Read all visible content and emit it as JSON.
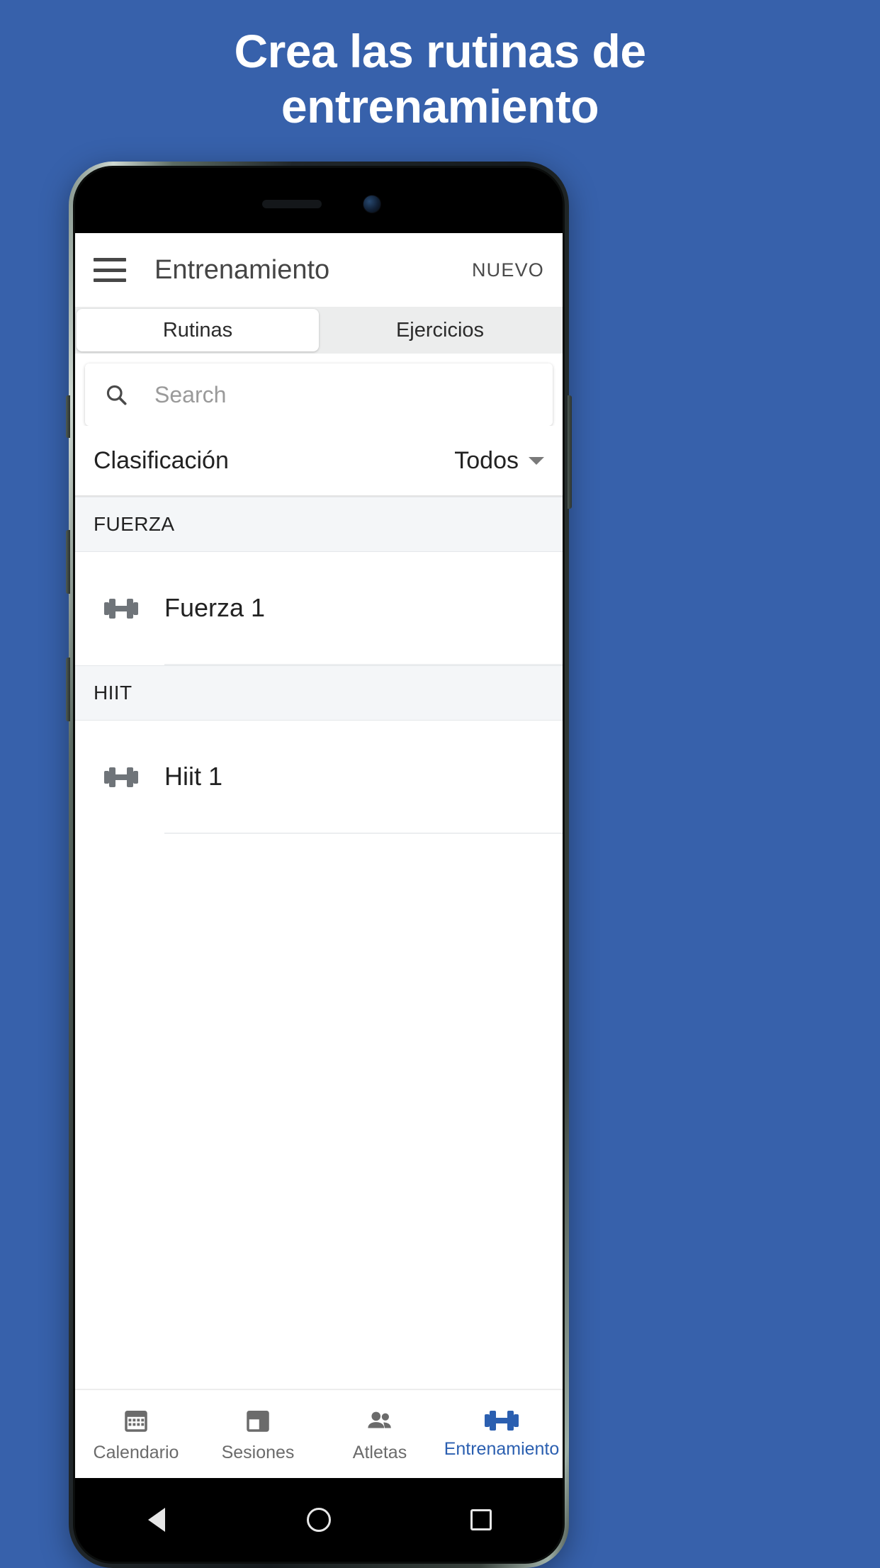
{
  "marketing": {
    "headline_line1": "Crea las rutinas de",
    "headline_line2": "entrenamiento",
    "background_color": "#3761ab",
    "headline_color": "#ffffff"
  },
  "app": {
    "toolbar": {
      "menu_icon": "hamburger-menu-icon",
      "title": "Entrenamiento",
      "action_label": "NUEVO"
    },
    "tabs": [
      {
        "label": "Rutinas",
        "active": true
      },
      {
        "label": "Ejercicios",
        "active": false
      }
    ],
    "search": {
      "icon": "search-icon",
      "placeholder": "Search",
      "value": ""
    },
    "filter": {
      "label": "Clasificación",
      "value": "Todos",
      "caret_icon": "chevron-down-icon"
    },
    "list": [
      {
        "group": "FUERZA",
        "items": [
          {
            "icon": "dumbbell-icon",
            "label": "Fuerza 1"
          }
        ]
      },
      {
        "group": "HIIT",
        "items": [
          {
            "icon": "dumbbell-icon",
            "label": "Hiit 1"
          }
        ]
      }
    ],
    "bottom_nav": {
      "accent_color": "#2b5fb0",
      "inactive_color": "#6b6b6b",
      "items": [
        {
          "label": "Calendario",
          "icon": "calendar-icon",
          "active": false
        },
        {
          "label": "Sesiones",
          "icon": "sessions-icon",
          "active": false
        },
        {
          "label": "Atletas",
          "icon": "people-icon",
          "active": false
        },
        {
          "label": "Entrenamiento",
          "icon": "dumbbell-icon",
          "active": true
        }
      ]
    }
  },
  "device": {
    "nav_buttons": [
      {
        "name": "back-button",
        "icon": "triangle-icon"
      },
      {
        "name": "home-button",
        "icon": "circle-icon"
      },
      {
        "name": "recents-button",
        "icon": "square-icon"
      }
    ]
  }
}
